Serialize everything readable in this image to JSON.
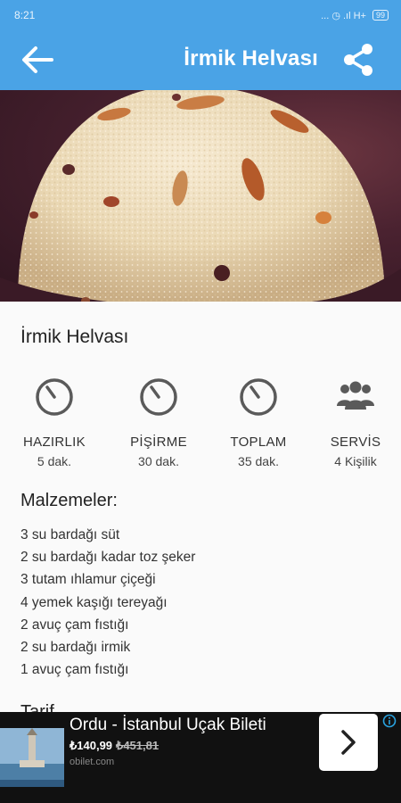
{
  "status_bar": {
    "time": "8:21",
    "indicators": "... ◷ .ıl H+",
    "battery": "99"
  },
  "app_bar": {
    "title": "İrmik Helvası",
    "back_icon": "arrow-left-icon",
    "share_icon": "share-icon"
  },
  "recipe": {
    "title": "İrmik Helvası",
    "stats": [
      {
        "icon": "timer-icon",
        "label": "HAZIRLIK",
        "value": "5 dak."
      },
      {
        "icon": "timer-icon",
        "label": "PİŞİRME",
        "value": "30 dak."
      },
      {
        "icon": "timer-icon",
        "label": "TOPLAM",
        "value": "35 dak."
      },
      {
        "icon": "users-icon",
        "label": "SERVİS",
        "value": "4 Kişilik"
      }
    ],
    "ingredients_title": "Malzemeler:",
    "ingredients": [
      "3 su bardağı süt",
      "2 su bardağı kadar toz şeker",
      "3 tutam ıhlamur çiçeği",
      "4 yemek kaşığı tereyağı",
      "2 avuç çam fıstığı",
      "2 su bardağı irmik",
      "1 avuç çam fıstığı"
    ],
    "next_section_peek": "Tarif"
  },
  "ad": {
    "title": "Ordu - İstanbul Uçak Bileti",
    "price": "₺140,99",
    "old_price": "₺451,81",
    "domain": "obilet.com",
    "cta_icon": "chevron-right-icon",
    "info_icon": "ad-choices-icon"
  },
  "colors": {
    "primary": "#4aa3e6",
    "ad_background": "#111111"
  }
}
